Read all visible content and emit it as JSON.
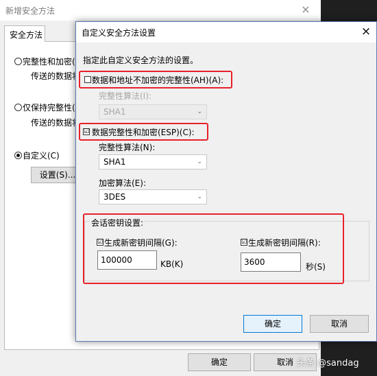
{
  "background_dialog": {
    "title": "新增安全方法",
    "tab": "安全方法",
    "options": [
      {
        "label": "完整性和加密(",
        "sub": "传送的数据将"
      },
      {
        "label": "仅保持完整性(",
        "sub": "传送的数据将"
      },
      {
        "label": "自定义(C)",
        "selected": true
      }
    ],
    "settings_button": "设置(S)...",
    "ok_button": "确定",
    "cancel_button": "取消"
  },
  "modal": {
    "title": "自定义安全方法设置",
    "description": "指定此自定义安全方法的设置。",
    "ah_checkbox": {
      "label": "数据和地址不加密的完整性(AH)(A):",
      "checked": false
    },
    "ah_integrity_label": "完整性算法(I):",
    "ah_integrity_value": "SHA1",
    "esp_checkbox": {
      "label": "数据完整性和加密(ESP)(C):",
      "checked": true
    },
    "esp_integrity_label": "完整性算法(N):",
    "esp_integrity_value": "SHA1",
    "encryption_label": "加密算法(E):",
    "encryption_value": "3DES",
    "session_key": {
      "group_label": "会话密钥设置:",
      "kb_checkbox": {
        "label": "生成新密钥间隔(G):",
        "checked": true
      },
      "kb_value": "100000",
      "kb_unit": "KB(K)",
      "sec_checkbox": {
        "label": "生成新密钥间隔(R):",
        "checked": true
      },
      "sec_value": "3600",
      "sec_unit": "秒(S)"
    },
    "ok_button": "确定",
    "cancel_button": "取消"
  },
  "icons": {
    "close": "×",
    "chevron": "⌄",
    "check": "☑"
  },
  "colors": {
    "highlight": "#e8202a",
    "accent": "#0078d7"
  },
  "watermark": "头条 @sandag"
}
